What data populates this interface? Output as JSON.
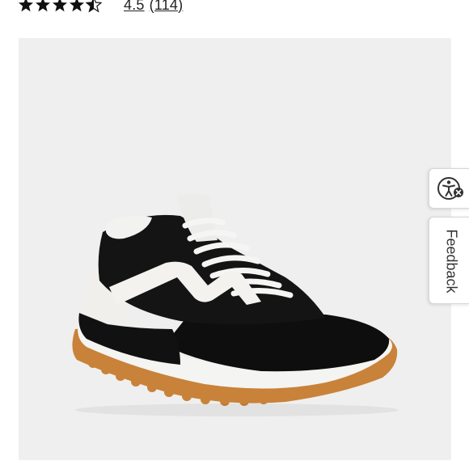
{
  "rating": {
    "score": "4.5",
    "count": "(114)",
    "stars_value": 4.5,
    "stars_max": 5
  },
  "product_image": {
    "subject": "black and white suede lace-up sneaker with gum sole",
    "icon": "sneaker-image"
  },
  "accessibility": {
    "icon": "accessibility-icon"
  },
  "feedback": {
    "label": "Feedback"
  },
  "colors": {
    "star": "#111111",
    "image_bg": "#efefef",
    "gum_sole": "#c98239"
  }
}
